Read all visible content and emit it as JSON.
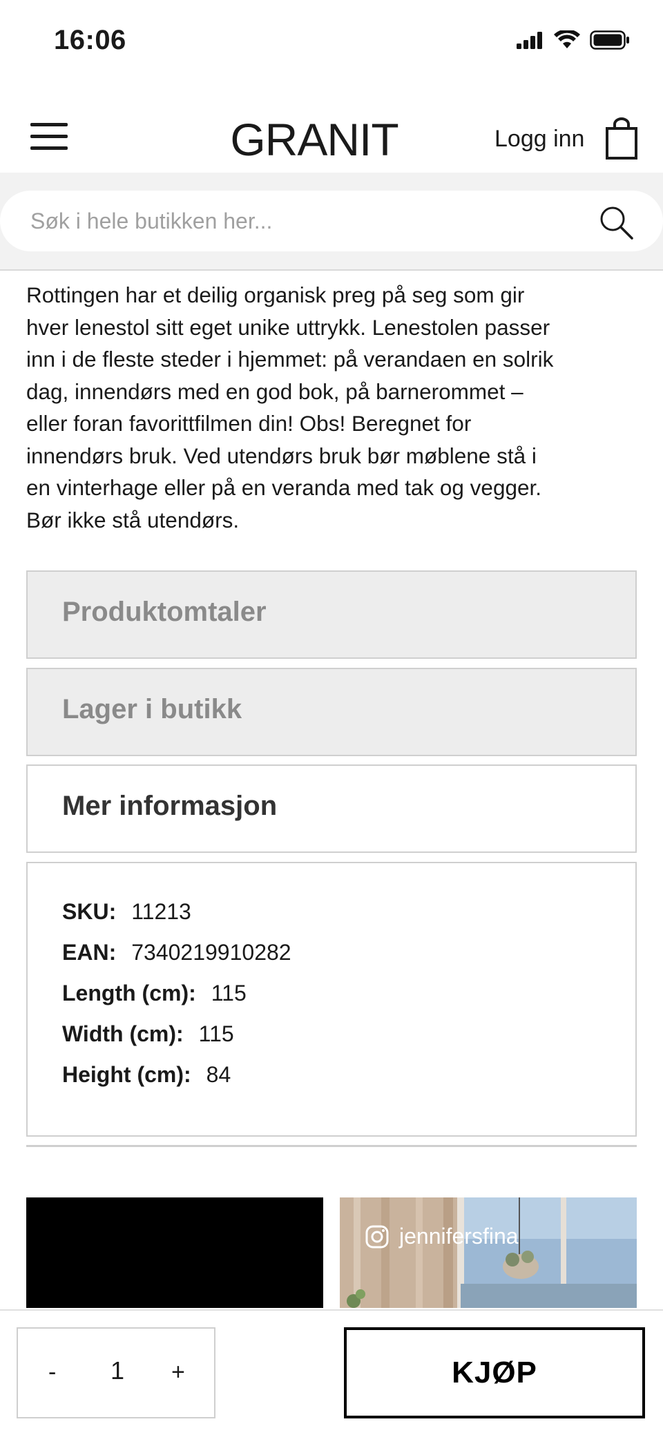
{
  "status_bar": {
    "time": "16:06",
    "icons": [
      "cellular-signal-icon",
      "wifi-icon",
      "battery-icon"
    ]
  },
  "header": {
    "logo": "GRANIT",
    "login_label": "Logg inn",
    "icons": [
      "hamburger-menu-icon",
      "shopping-bag-icon"
    ]
  },
  "search": {
    "placeholder": "Søk i hele butikken her...",
    "icon": "search-icon"
  },
  "description": {
    "lines": [
      "Rottingen har et deilig organisk preg på seg som gir",
      "hver lenestol sitt eget unike uttrykk. Lenestolen passer",
      "inn i de fleste steder i hjemmet: på verandaen en solrik",
      "dag, innendørs med en god bok, på barnerommet –",
      "eller foran favorittfilmen din! Obs! Beregnet for",
      "innendørs bruk. Ved utendørs bruk bør møblene stå i",
      "en vinterhage eller på en veranda med tak og vegger.",
      "Bør ikke stå utendørs."
    ]
  },
  "accordion": {
    "reviews_label": "Produktomtaler",
    "stock_label": "Lager i butikk",
    "more_info_label": "Mer informasjon"
  },
  "more_info": {
    "rows": [
      {
        "label": "SKU:",
        "value": "11213"
      },
      {
        "label": "EAN:",
        "value": "7340219910282"
      },
      {
        "label": "Length (cm):",
        "value": "115"
      },
      {
        "label": "Width (cm):",
        "value": "115"
      },
      {
        "label": "Height (cm):",
        "value": "84"
      }
    ]
  },
  "gallery": {
    "instagram_handle": "jennifersfina",
    "icon": "instagram-icon"
  },
  "purchase": {
    "minus": "-",
    "quantity": "1",
    "plus": "+",
    "buy_label": "KJØP"
  },
  "colors": {
    "text": "#1a1a1a",
    "muted": "#8a8a8a",
    "panel_gray": "#ededed",
    "border": "#cfcfcf",
    "search_band": "#f2f2f2"
  }
}
